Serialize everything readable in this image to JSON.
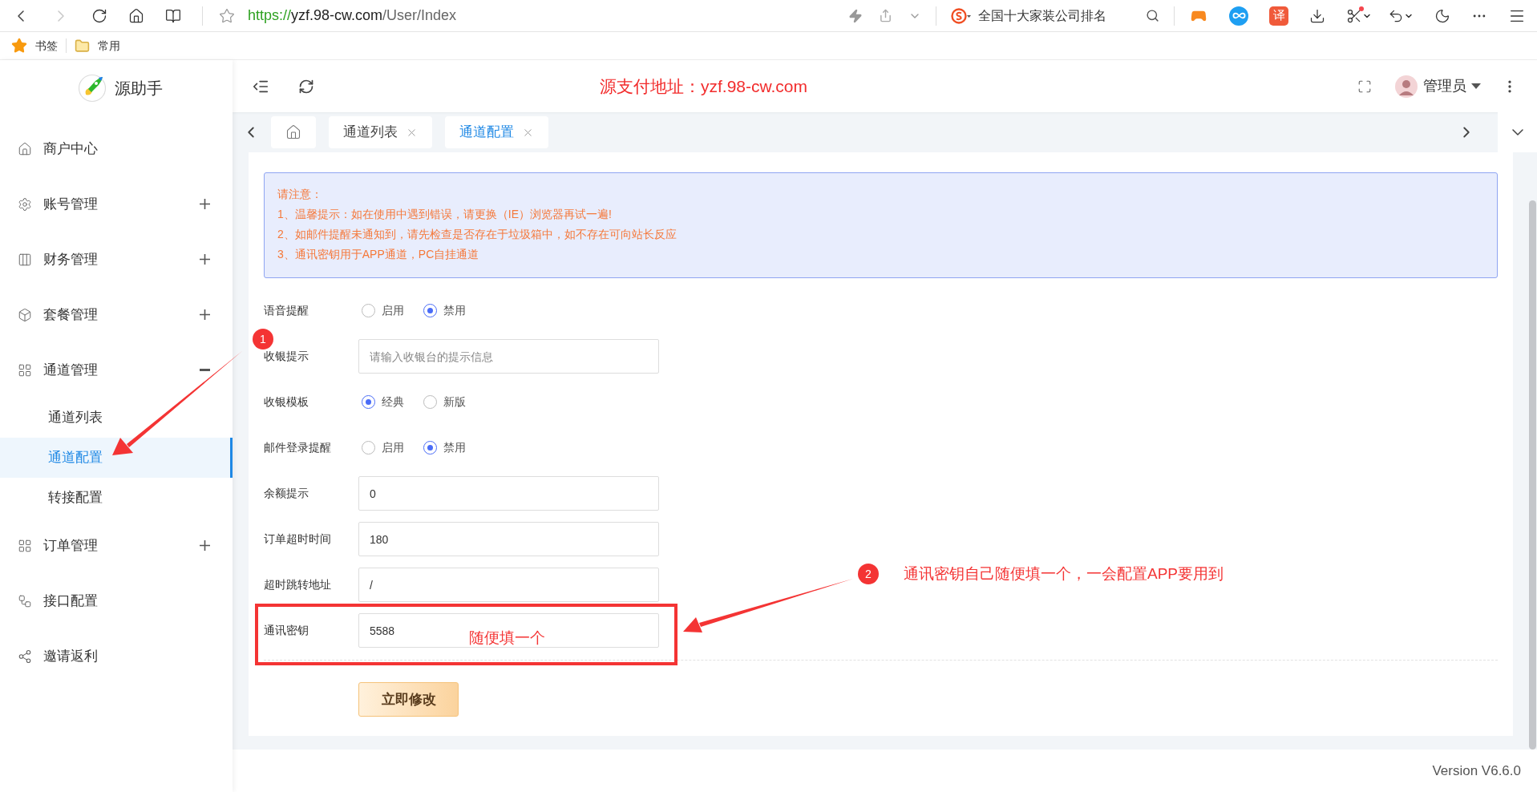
{
  "browser": {
    "forward": {
      "disabled": true
    },
    "url": {
      "scheme": "https://",
      "host": "yzf.98-cw.com",
      "path": "/User/Index"
    },
    "search_text": "全国十大家装公司排名",
    "translate_label": "译",
    "bookmarks": [
      {
        "kind": "star",
        "label": "书签"
      },
      {
        "kind": "folder",
        "label": "常用"
      }
    ]
  },
  "app": {
    "logo_text": "源助手",
    "notice": "源支付地址：yzf.98-cw.com",
    "user": "管理员"
  },
  "sidebar": {
    "items": [
      {
        "kind": "link",
        "label": "商户中心"
      },
      {
        "kind": "group",
        "label": "账号管理",
        "expanded": false
      },
      {
        "kind": "group",
        "label": "财务管理",
        "expanded": false
      },
      {
        "kind": "group",
        "label": "套餐管理",
        "expanded": false
      },
      {
        "kind": "group",
        "label": "通道管理",
        "expanded": true,
        "children": [
          {
            "label": "通道列表",
            "selected": false
          },
          {
            "label": "通道配置",
            "selected": true
          },
          {
            "label": "转接配置",
            "selected": false
          }
        ]
      },
      {
        "kind": "group",
        "label": "订单管理",
        "expanded": false
      },
      {
        "kind": "link",
        "label": "接口配置"
      },
      {
        "kind": "link",
        "label": "邀请返利"
      }
    ]
  },
  "tabs": [
    {
      "kind": "home",
      "selected": false
    },
    {
      "kind": "page",
      "label": "通道列表",
      "selected": false
    },
    {
      "kind": "page",
      "label": "通道配置",
      "selected": true
    }
  ],
  "alert": {
    "title": "请注意：",
    "lines": [
      "1、温馨提示：如在使用中遇到错误，请更换（IE）浏览器再试一遍!",
      "2、如邮件提醒未通知到，请先检查是否存在于垃圾箱中，如不存在可向站长反应",
      "3、通讯密钥用于APP通道，PC自挂通道"
    ]
  },
  "form": [
    {
      "kind": "radio",
      "label": "语音提醒",
      "options": [
        {
          "label": "启用",
          "selected": false
        },
        {
          "label": "禁用",
          "selected": true
        }
      ]
    },
    {
      "kind": "input",
      "label": "收银提示",
      "placeholder": "请输入收银台的提示信息"
    },
    {
      "kind": "radio",
      "label": "收银模板",
      "options": [
        {
          "label": "经典",
          "selected": true
        },
        {
          "label": "新版",
          "selected": false
        }
      ]
    },
    {
      "kind": "radio",
      "label": "邮件登录提醒",
      "options": [
        {
          "label": "启用",
          "selected": false
        },
        {
          "label": "禁用",
          "selected": true
        }
      ]
    },
    {
      "kind": "input",
      "label": "余额提示",
      "value": "0"
    },
    {
      "kind": "input",
      "label": "订单超时时间",
      "value": "180"
    },
    {
      "kind": "input",
      "label": "超时跳转地址",
      "value": "/"
    },
    {
      "kind": "input",
      "label": "通讯密钥",
      "value": "5588"
    }
  ],
  "submit": "立即修改",
  "annotations": {
    "markers": [
      "1",
      "2"
    ],
    "note": "通讯密钥自己随便填一个，一会配置APP要用到",
    "inline_note": "随便填一个"
  },
  "footer": {
    "version": "Version V6.6.0"
  }
}
